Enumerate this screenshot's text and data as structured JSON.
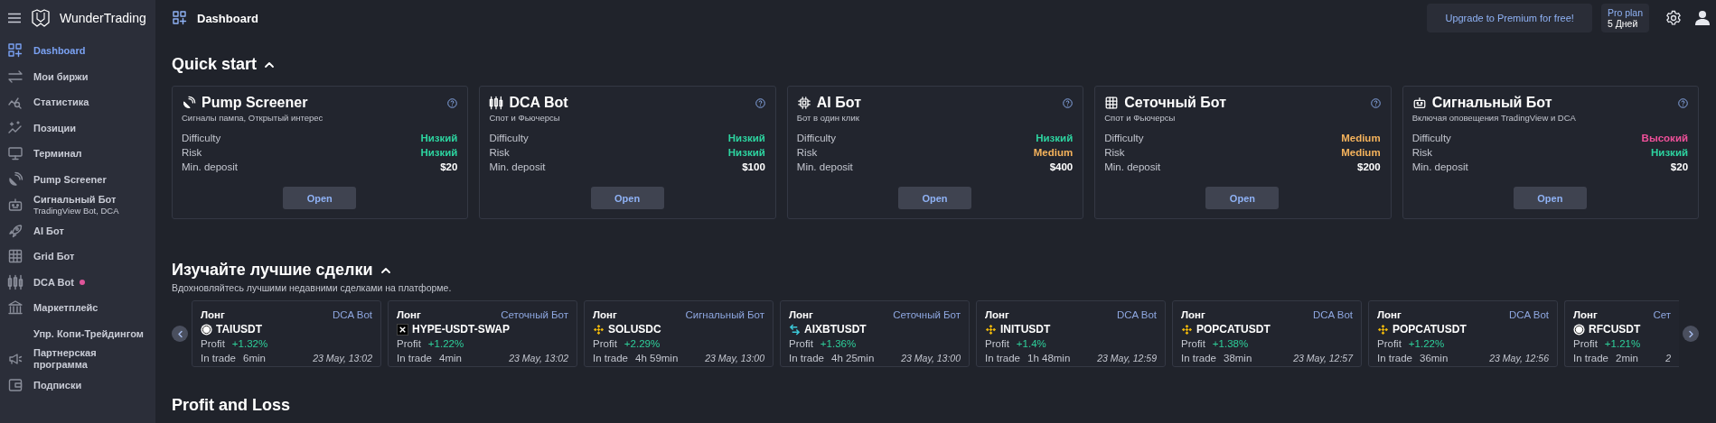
{
  "sidebar": {
    "brand": "WunderTrading",
    "items": [
      {
        "label": "Dashboard",
        "selected": true,
        "new_dot": false
      },
      {
        "label": "Мои биржи",
        "selected": false,
        "new_dot": false
      },
      {
        "label": "Статистика",
        "selected": false,
        "new_dot": false
      },
      {
        "label": "Позиции",
        "selected": false,
        "new_dot": false
      },
      {
        "label": "Терминал",
        "selected": false,
        "new_dot": false
      },
      {
        "label": "Pump Screener",
        "selected": false,
        "new_dot": false
      },
      {
        "label": "Сигнальный Бот",
        "subtitle": "TradingView Bot, DCA",
        "selected": false,
        "new_dot": false
      },
      {
        "label": "AI Бот",
        "selected": false,
        "new_dot": false
      },
      {
        "label": "Grid Бот",
        "selected": false,
        "new_dot": false
      },
      {
        "label": "DCA Bot",
        "selected": false,
        "new_dot": true
      },
      {
        "label": "Маркетплейс",
        "selected": false,
        "new_dot": false
      },
      {
        "label": "Упр. Копи-Трейдингом",
        "selected": false,
        "new_dot": false
      },
      {
        "label": "Партнерская программа",
        "selected": false,
        "new_dot": false
      },
      {
        "label": "Подписки",
        "selected": false,
        "new_dot": false
      }
    ]
  },
  "topbar": {
    "title": "Dashboard",
    "upgrade": "Upgrade to Premium for free!",
    "plan": "Pro plan",
    "plan_days": "5 Дней"
  },
  "quick_start": {
    "title": "Quick start",
    "expanded": true,
    "cards": [
      {
        "title": "Pump Screener",
        "subtitle": "Сигналы пампа, Открытый интерес",
        "rows": [
          {
            "label": "Difficulty",
            "value": "Низкий",
            "color": "#2dd4a0"
          },
          {
            "label": "Risk",
            "value": "Низкий",
            "color": "#2dd4a0"
          },
          {
            "label": "Min. deposit",
            "value": "$20",
            "color": "#ffffff"
          }
        ],
        "button": "Open"
      },
      {
        "title": "DCA Bot",
        "subtitle": "Спот и Фьючерсы",
        "rows": [
          {
            "label": "Difficulty",
            "value": "Низкий",
            "color": "#2dd4a0"
          },
          {
            "label": "Risk",
            "value": "Низкий",
            "color": "#2dd4a0"
          },
          {
            "label": "Min. deposit",
            "value": "$100",
            "color": "#ffffff"
          }
        ],
        "button": "Open"
      },
      {
        "title": "AI Бот",
        "subtitle": "Бот в один клик",
        "rows": [
          {
            "label": "Difficulty",
            "value": "Низкий",
            "color": "#2dd4a0"
          },
          {
            "label": "Risk",
            "value": "Medium",
            "color": "#f5b35c"
          },
          {
            "label": "Min. deposit",
            "value": "$400",
            "color": "#ffffff"
          }
        ],
        "button": "Open"
      },
      {
        "title": "Сеточный Бот",
        "subtitle": "Спот и Фьючерсы",
        "rows": [
          {
            "label": "Difficulty",
            "value": "Medium",
            "color": "#f5b35c"
          },
          {
            "label": "Risk",
            "value": "Medium",
            "color": "#f5b35c"
          },
          {
            "label": "Min. deposit",
            "value": "$200",
            "color": "#ffffff"
          }
        ],
        "button": "Open"
      },
      {
        "title": "Сигнальный Бот",
        "subtitle": "Включая оповещения TradingView и DCA",
        "rows": [
          {
            "label": "Difficulty",
            "value": "Высокий",
            "color": "#f0509a"
          },
          {
            "label": "Risk",
            "value": "Низкий",
            "color": "#2dd4a0"
          },
          {
            "label": "Min. deposit",
            "value": "$20",
            "color": "#ffffff"
          }
        ],
        "button": "Open"
      }
    ]
  },
  "top_trades": {
    "title": "Изучайте лучшие сделки",
    "expanded": true,
    "subtitle": "Вдохновляйтесь лучшими недавними сделками на платформе.",
    "items": [
      {
        "side": "Лонг",
        "bot": "DCA Bot",
        "pair": "TAIUSDT",
        "profit_label": "Profit",
        "profit": "+1.32%",
        "time_label": "In trade",
        "duration": "6min",
        "date": "23 May, 13:02"
      },
      {
        "side": "Лонг",
        "bot": "Сеточный Бот",
        "pair": "HYPE-USDT-SWAP",
        "profit_label": "Profit",
        "profit": "+1.22%",
        "time_label": "In trade",
        "duration": "4min",
        "date": "23 May, 13:02"
      },
      {
        "side": "Лонг",
        "bot": "Сигнальный Бот",
        "pair": "SOLUSDC",
        "profit_label": "Profit",
        "profit": "+2.29%",
        "time_label": "In trade",
        "duration": "4h 59min",
        "date": "23 May, 13:00"
      },
      {
        "side": "Лонг",
        "bot": "Сеточный Бот",
        "pair": "AIXBTUSDT",
        "profit_label": "Profit",
        "profit": "+1.36%",
        "time_label": "In trade",
        "duration": "4h 25min",
        "date": "23 May, 13:00"
      },
      {
        "side": "Лонг",
        "bot": "DCA Bot",
        "pair": "INITUSDT",
        "profit_label": "Profit",
        "profit": "+1.4%",
        "time_label": "In trade",
        "duration": "1h 48min",
        "date": "23 May, 12:59"
      },
      {
        "side": "Лонг",
        "bot": "DCA Bot",
        "pair": "POPCATUSDT",
        "profit_label": "Profit",
        "profit": "+1.38%",
        "time_label": "In trade",
        "duration": "38min",
        "date": "23 May, 12:57"
      },
      {
        "side": "Лонг",
        "bot": "DCA Bot",
        "pair": "POPCATUSDT",
        "profit_label": "Profit",
        "profit": "+1.22%",
        "time_label": "In trade",
        "duration": "36min",
        "date": "23 May, 12:56"
      },
      {
        "side": "Лонг",
        "bot": "Сет",
        "pair": "RFCUSDT",
        "profit_label": "Profit",
        "profit": "+1.21%",
        "time_label": "In trade",
        "duration": "2min",
        "date": "2"
      }
    ]
  },
  "pnl": {
    "title": "Profit and Loss"
  }
}
